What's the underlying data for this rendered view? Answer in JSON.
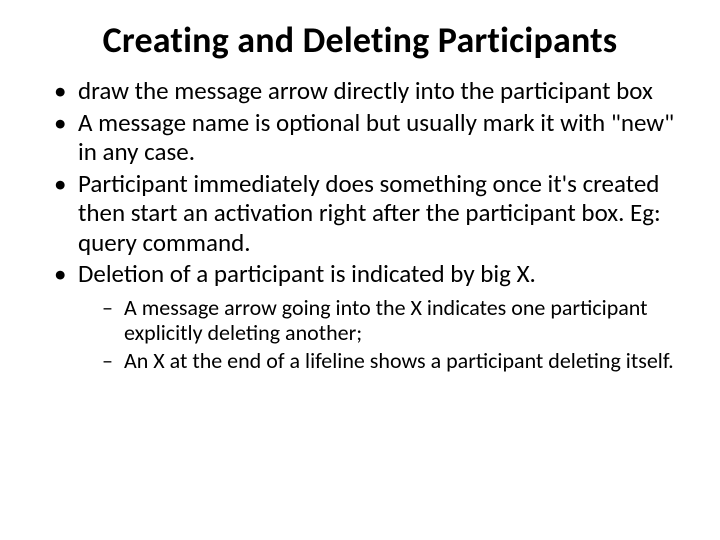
{
  "title": "Creating and Deleting Participants",
  "bullets": [
    "draw the message arrow directly into the participant box",
    "A message name is optional but usually mark it with \"new\" in any case.",
    "Participant immediately does something once it's created then start an activation right after the participant box. Eg: query command.",
    "Deletion of a participant is indicated by big X."
  ],
  "subbullets": [
    "A message arrow going into the X indicates one participant explicitly deleting another;",
    "An X at the end of a lifeline shows a participant deleting itself."
  ]
}
